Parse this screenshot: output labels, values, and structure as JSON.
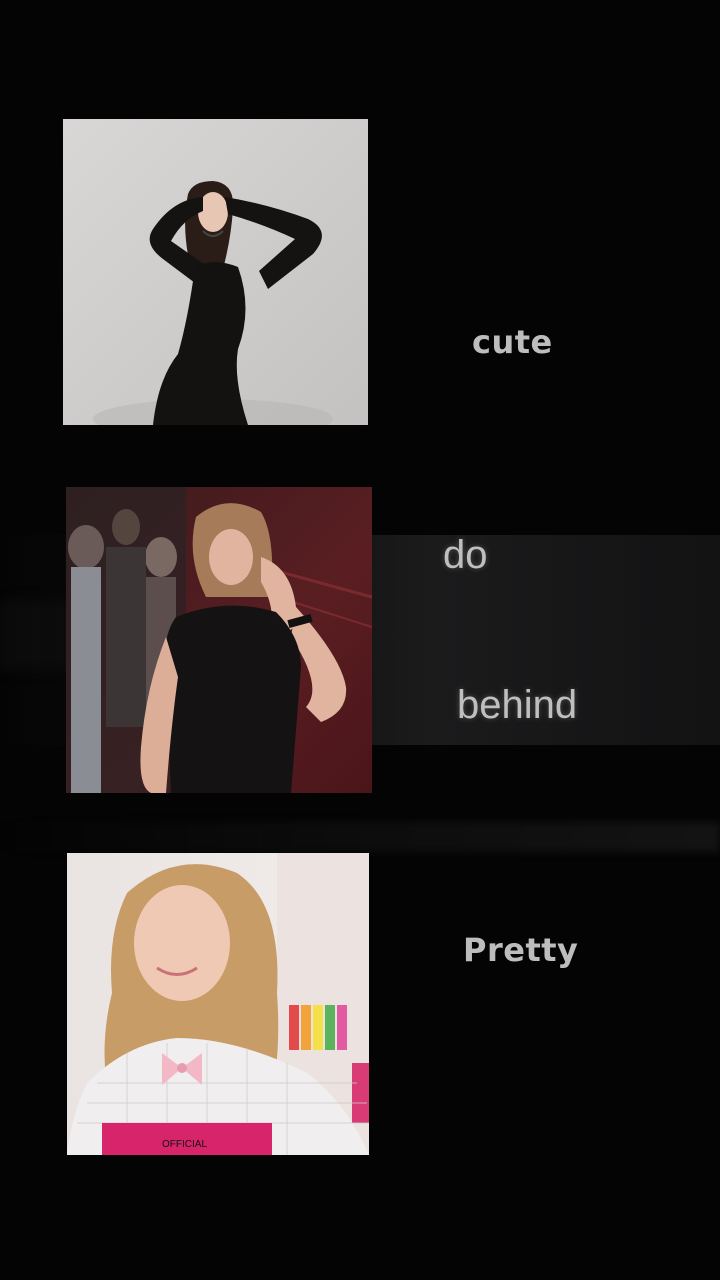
{
  "captions": {
    "cute": "cute",
    "do": "do",
    "behind": "behind",
    "pretty": "Pretty"
  },
  "photos": [
    {
      "subject": "woman in black long-sleeve dress posing against light grey wall"
    },
    {
      "subject": "girl in black top touching hair in crowded red-lit room"
    },
    {
      "subject": "blonde girl in white mesh top with pink bow"
    }
  ],
  "colors": {
    "background": "#040404",
    "caption": "#bdbdbd"
  }
}
